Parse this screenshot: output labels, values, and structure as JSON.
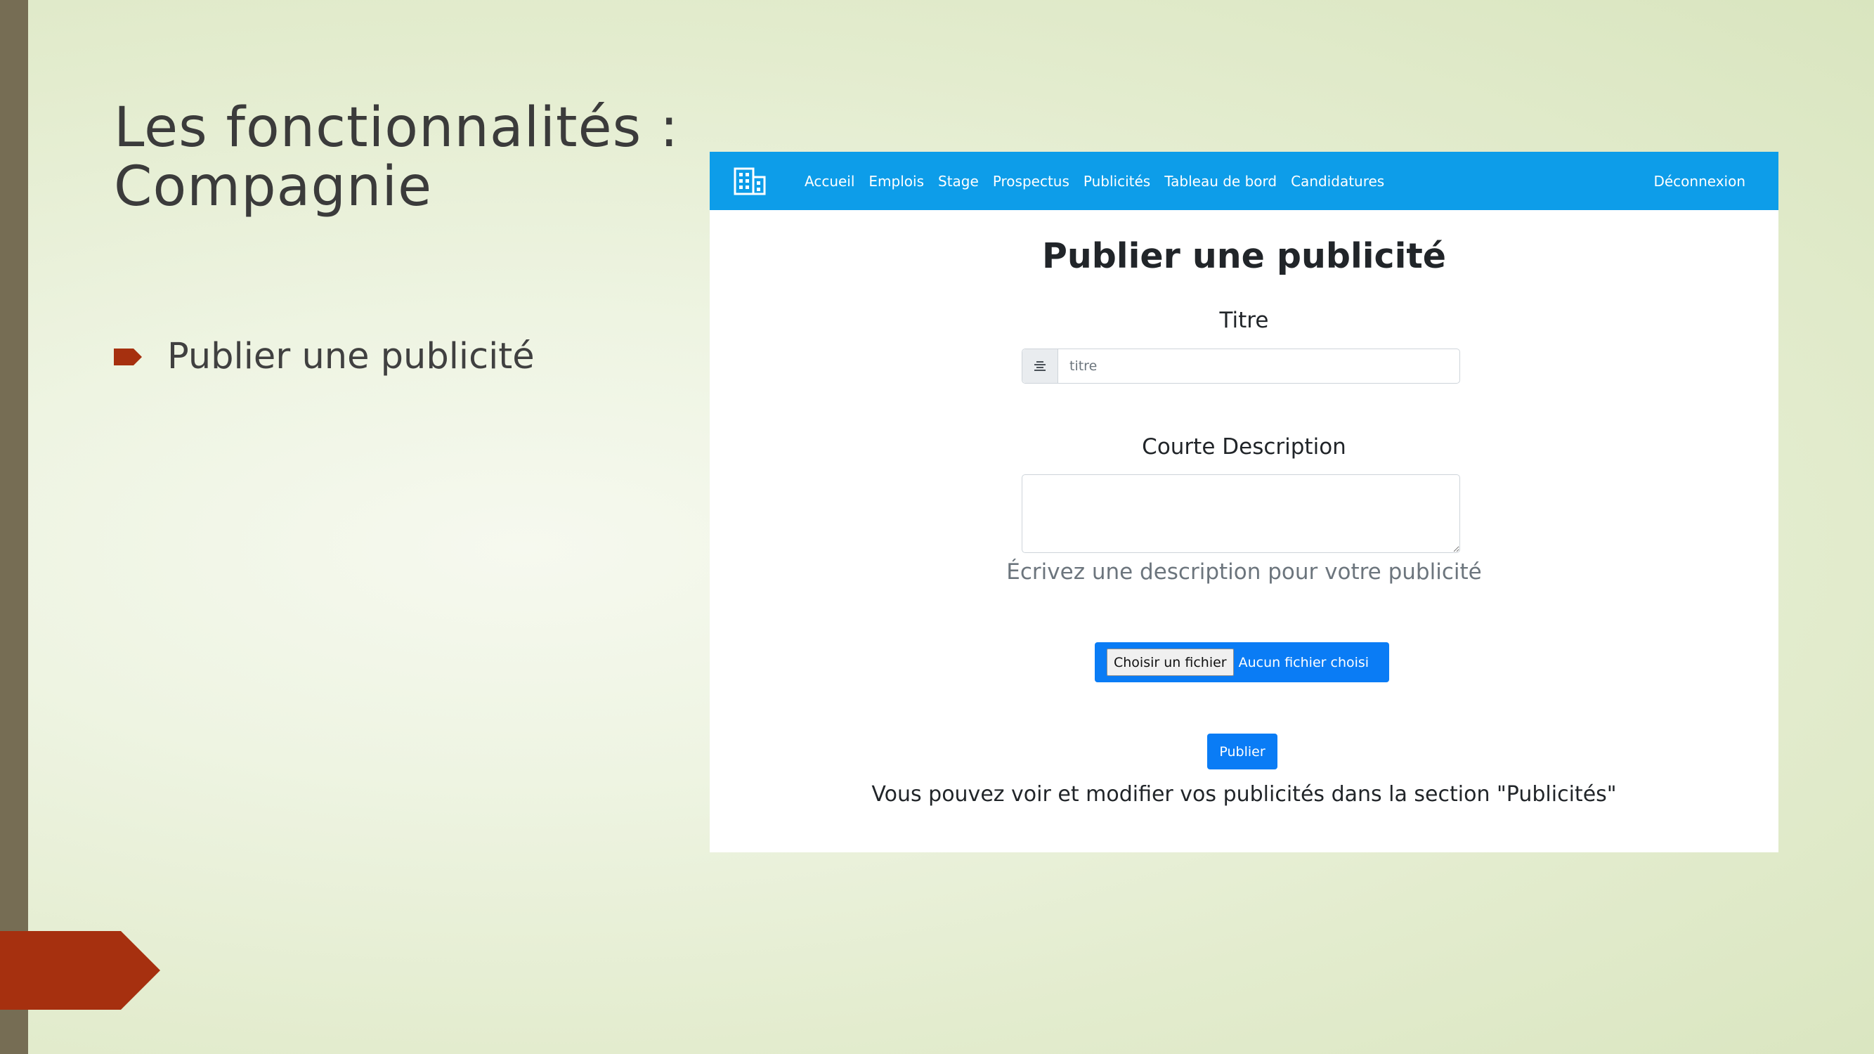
{
  "slide": {
    "title_line1": "Les fonctionnalités :",
    "title_line2": "Compagnie",
    "bullet": "Publier une publicité"
  },
  "navbar": {
    "logo_icon": "building-icon",
    "links": [
      "Accueil",
      "Emplois",
      "Stage",
      "Prospectus",
      "Publicités",
      "Tableau de bord",
      "Candidatures"
    ],
    "logout": "Déconnexion",
    "color": "#0d9de9"
  },
  "form": {
    "heading": "Publier une publicité",
    "title_label": "Titre",
    "title_placeholder": "titre",
    "title_icon": "align-center-icon",
    "description_label": "Courte Description",
    "description_help": "Écrivez une description pour votre publicité",
    "file_button": "Choisir un fichier",
    "file_status": "Aucun fichier choisi",
    "submit": "Publier",
    "footer": "Vous pouvez voir et modifier vos publicités dans la section \"Publicités\""
  },
  "colors": {
    "accent_bar": "#766d54",
    "arrow": "#a6300f",
    "button_blue": "#0a7cf5"
  }
}
